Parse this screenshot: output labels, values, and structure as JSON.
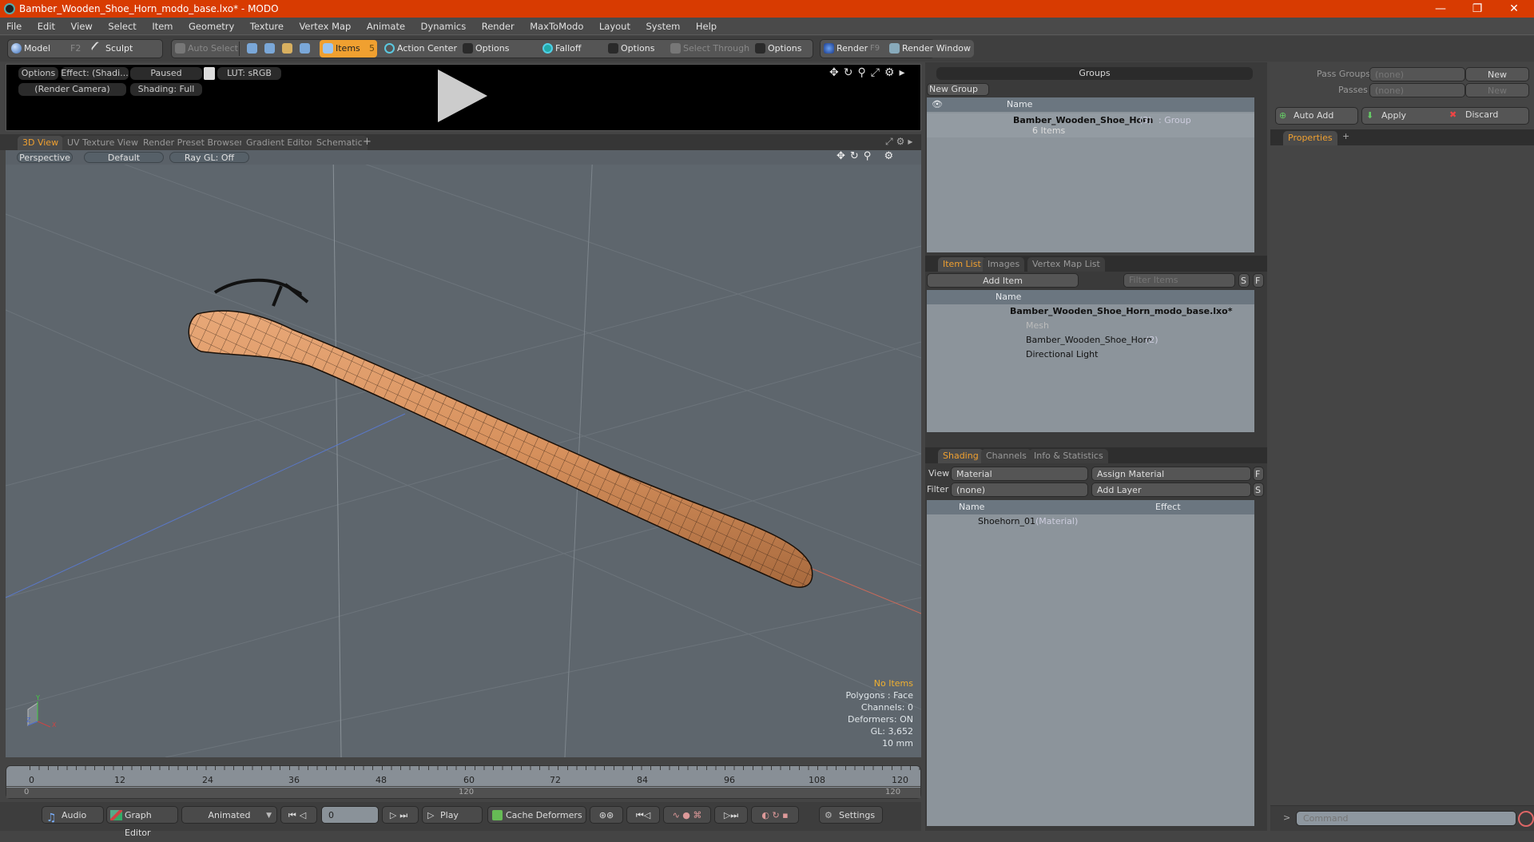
{
  "window": {
    "title": "Bamber_Wooden_Shoe_Horn_modo_base.lxo* - MODO",
    "minimize": "—",
    "restore": "❐",
    "close": "✕"
  },
  "menu": [
    "File",
    "Edit",
    "View",
    "Select",
    "Item",
    "Geometry",
    "Texture",
    "Vertex Map",
    "Animate",
    "Dynamics",
    "Render",
    "MaxToModo",
    "Layout",
    "System",
    "Help"
  ],
  "toolbar": {
    "model": "Model",
    "model_key": "F2",
    "sculpt": "Sculpt",
    "auto_select": "Auto Select",
    "items": "Items",
    "items_key": "5",
    "action_center": "Action Center",
    "options1": "Options",
    "falloff": "Falloff",
    "options2": "Options",
    "select_through": "Select Through",
    "options3": "Options",
    "render": "Render",
    "render_key": "F9",
    "render_window": "Render Window"
  },
  "render_preview": {
    "options": "Options",
    "effect": "Effect: (Shadi...",
    "paused": "Paused",
    "lut": "LUT: sRGB",
    "camera": "(Render Camera)",
    "shading": "Shading: Full"
  },
  "viewport_tabs": [
    "3D View",
    "UV Texture View",
    "Render Preset Browser",
    "Gradient Editor",
    "Schematic"
  ],
  "viewport": {
    "projection": "Perspective",
    "style": "Default",
    "raygl": "Ray GL: Off",
    "stats": {
      "selection": "No Items",
      "polygons": "Polygons : Face",
      "channels": "Channels: 0",
      "deformers": "Deformers: ON",
      "gl": "GL: 3,652",
      "unit": "10 mm"
    },
    "accent": "#f0a030"
  },
  "timeline": {
    "ticks": [
      "0",
      "12",
      "24",
      "36",
      "48",
      "60",
      "72",
      "84",
      "96",
      "108",
      "120"
    ],
    "range_start": "0",
    "range_mid": "120",
    "range_end": "120"
  },
  "transport": {
    "audio": "Audio",
    "graph_editor": "Graph Editor",
    "animated": "Animated",
    "frame": "0",
    "play": "Play",
    "cache_deformers": "Cache Deformers",
    "settings": "Settings"
  },
  "groups": {
    "title": "Groups",
    "new_group": "New Group",
    "col_name": "Name",
    "row_name": "Bamber_Wooden_Shoe_Horn",
    "row_count": "(3)",
    "row_type": ": Group",
    "row_sub": "6 Items"
  },
  "item_list": {
    "tabs": [
      "Item List",
      "Images",
      "Vertex Map List"
    ],
    "add_item": "Add Item",
    "filter_placeholder": "Filter Items",
    "s": "S",
    "f": "F",
    "col_name": "Name",
    "rows": [
      {
        "name": "Bamber_Wooden_Shoe_Horn_modo_base.lxo*",
        "extra": ""
      },
      {
        "name": "Mesh",
        "extra": ""
      },
      {
        "name": "Bamber_Wooden_Shoe_Horn",
        "extra": "(2)"
      },
      {
        "name": "Directional Light",
        "extra": ""
      }
    ]
  },
  "shading": {
    "tabs": [
      "Shading",
      "Channels",
      "Info & Statistics"
    ],
    "view_label": "View",
    "view_value": "Material",
    "assign_material": "Assign Material",
    "filter_label": "Filter",
    "filter_value": "(none)",
    "add_layer": "Add Layer",
    "f": "F",
    "s": "S",
    "col_name": "Name",
    "col_effect": "Effect",
    "rows": [
      {
        "name": "Shoehorn_01",
        "type": "(Material)"
      }
    ]
  },
  "passes": {
    "pass_groups_label": "Pass Groups",
    "pass_groups_value": "(none)",
    "passes_label": "Passes",
    "passes_value": "(none)",
    "new1": "New",
    "new2": "New",
    "auto_add": "Auto Add",
    "apply": "Apply",
    "discard": "Discard"
  },
  "properties": {
    "tab": "Properties"
  },
  "command": {
    "prompt": ">",
    "placeholder": "Command"
  }
}
